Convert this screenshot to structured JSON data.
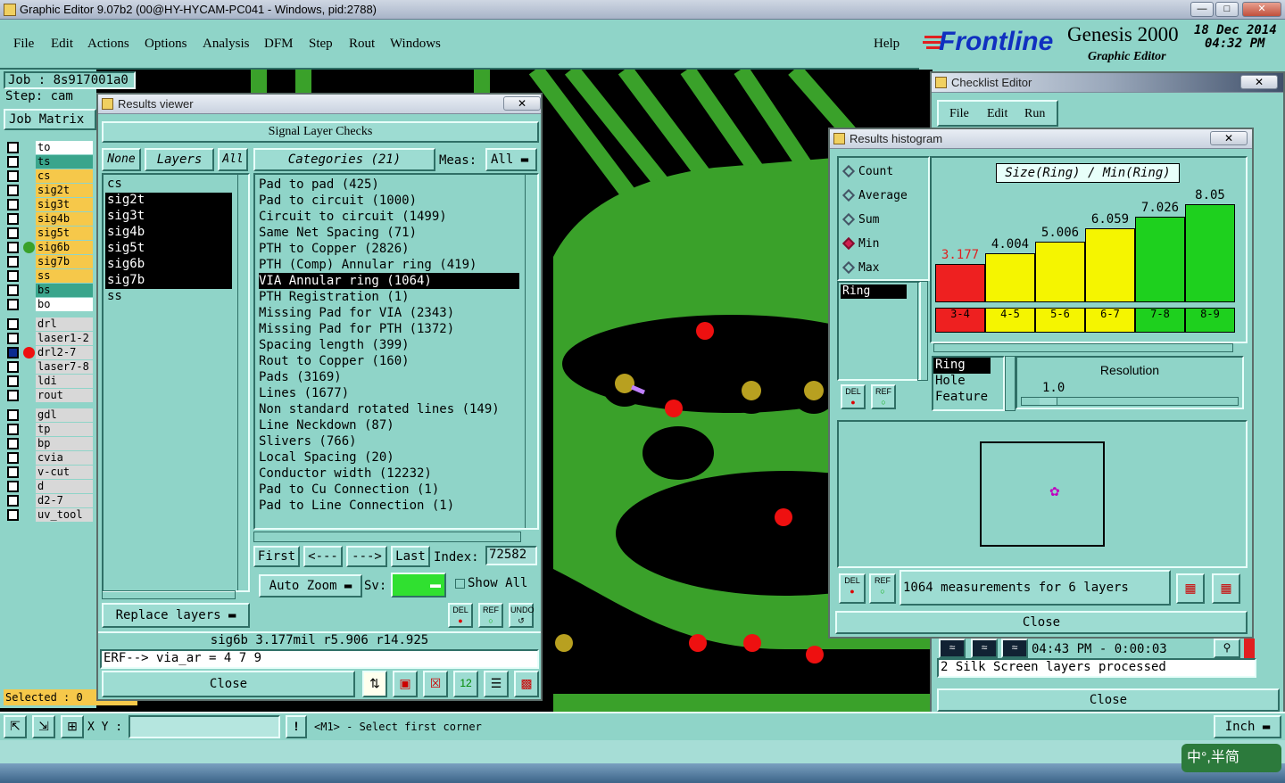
{
  "window": {
    "title": "Graphic Editor 9.07b2 (00@HY-HYCAM-PC041 - Windows, pid:2788)"
  },
  "menu": {
    "file": "File",
    "edit": "Edit",
    "actions": "Actions",
    "options": "Options",
    "analysis": "Analysis",
    "dfm": "DFM",
    "step": "Step",
    "rout": "Rout",
    "windows": "Windows",
    "help": "Help"
  },
  "brand": {
    "logo": "Frontline",
    "product": "Genesis 2000",
    "subtitle": "Graphic Editor",
    "date": "18 Dec 2014",
    "time": "04:32 PM"
  },
  "left": {
    "job": "Job : 8s917001a0",
    "step": "Step: cam",
    "job_matrix": "Job Matrix",
    "selected": "Selected : 0",
    "layers": [
      {
        "name": "to",
        "color": "#ffffff"
      },
      {
        "name": "ts",
        "color": "#3aa58c"
      },
      {
        "name": "cs",
        "color": "#f6c84a"
      },
      {
        "name": "sig2t",
        "color": "#f6c84a"
      },
      {
        "name": "sig3t",
        "color": "#f6c84a"
      },
      {
        "name": "sig4b",
        "color": "#f6c84a"
      },
      {
        "name": "sig5t",
        "color": "#f6c84a"
      },
      {
        "name": "sig6b",
        "color": "#f6c84a"
      },
      {
        "name": "sig7b",
        "color": "#f6c84a"
      },
      {
        "name": "ss",
        "color": "#f6c84a"
      },
      {
        "name": "bs",
        "color": "#3aa58c"
      },
      {
        "name": "bo",
        "color": "#ffffff"
      },
      {
        "name": "drl",
        "color": "#d8d8d8"
      },
      {
        "name": "laser1-2",
        "color": "#d8d8d8"
      },
      {
        "name": "drl2-7",
        "color": "#d8d8d8"
      },
      {
        "name": "laser7-8",
        "color": "#d8d8d8"
      },
      {
        "name": "ldi",
        "color": "#d8d8d8"
      },
      {
        "name": "rout",
        "color": "#d8d8d8"
      },
      {
        "name": "gdl",
        "color": "#d8d8d8"
      },
      {
        "name": "tp",
        "color": "#d8d8d8"
      },
      {
        "name": "bp",
        "color": "#d8d8d8"
      },
      {
        "name": "cvia",
        "color": "#d8d8d8"
      },
      {
        "name": "v-cut",
        "color": "#d8d8d8"
      },
      {
        "name": "d",
        "color": "#d8d8d8"
      },
      {
        "name": "d2-7",
        "color": "#d8d8d8"
      },
      {
        "name": "uv_tool",
        "color": "#d8d8d8"
      }
    ]
  },
  "results": {
    "title": "Results viewer",
    "header": "Signal Layer Checks",
    "none_btn": "None",
    "layers_btn": "Layers",
    "all_btn": "All",
    "categories_btn": "Categories (21)",
    "meas_label": "Meas:",
    "meas_value": "All",
    "layer_list": [
      "cs",
      "sig2t",
      "sig3t",
      "sig4b",
      "sig5t",
      "sig6b",
      "sig7b",
      "ss"
    ],
    "categories": [
      "Pad to pad (425)",
      "Pad to circuit (1000)",
      "Circuit to circuit (1499)",
      "Same Net Spacing (71)",
      "PTH to Copper (2826)",
      "PTH (Comp) Annular ring (419)",
      "VIA Annular ring (1064)",
      "PTH Registration (1)",
      "Missing Pad for VIA (2343)",
      "Missing Pad for PTH (1372)",
      "Spacing length (399)",
      "Rout to Copper (160)",
      "Pads (3169)",
      "Lines (1677)",
      "Non standard rotated lines (149)",
      "Line Neckdown (87)",
      "Slivers (766)",
      "Local Spacing (20)",
      "Conductor width (12232)",
      "Pad to Cu Connection (1)",
      "Pad to Line Connection (1)"
    ],
    "first": "First",
    "prev": "<---",
    "next": "--->",
    "last": "Last",
    "index_label": "Index:",
    "index_value": "72582",
    "replace_layers": "Replace layers",
    "auto_zoom": "Auto Zoom",
    "sv_label": "Sv:",
    "show_all": "Show All",
    "del": "DEL",
    "ref": "REF",
    "undo": "UNDO",
    "info_line": "sig6b 3.177mil   r5.906   r14.925",
    "erf_line": "ERF--> via_ar = 4 7 9",
    "close": "Close"
  },
  "checklist": {
    "title": "Checklist Editor",
    "file": "File",
    "edit": "Edit",
    "run": "Run",
    "status_time": "04:43 PM - 0:00:03",
    "status_msg": "2 Silk Screen layers processed",
    "close": "Close"
  },
  "histogram": {
    "title": "Results histogram",
    "modes": [
      "Count",
      "Average",
      "Sum",
      "Min",
      "Max"
    ],
    "selected_mode": "Min",
    "chart_title": "Size(Ring) / Min(Ring)",
    "list_item": "Ring",
    "params": [
      "Ring",
      "Hole",
      "Feature"
    ],
    "resolution_label": "Resolution",
    "resolution_value": "1.0",
    "summary": "1064 measurements for 6 layers",
    "del": "DEL",
    "ref": "REF",
    "close": "Close"
  },
  "chart_data": {
    "type": "bar",
    "title": "Size(Ring) / Min(Ring)",
    "categories": [
      "3-4",
      "4-5",
      "5-6",
      "6-7",
      "7-8",
      "8-9"
    ],
    "values": [
      3.177,
      4.004,
      5.006,
      6.059,
      7.026,
      8.05
    ],
    "colors": [
      "#ee2020",
      "#f5f500",
      "#f5f500",
      "#f5f500",
      "#1ed01e",
      "#1ed01e"
    ],
    "ylim": [
      0,
      9
    ]
  },
  "statusbar": {
    "xy_label": "X Y :",
    "hint": "<M1> - Select first corner",
    "units": "Inch"
  },
  "ime": {
    "text": "中°,半简"
  }
}
